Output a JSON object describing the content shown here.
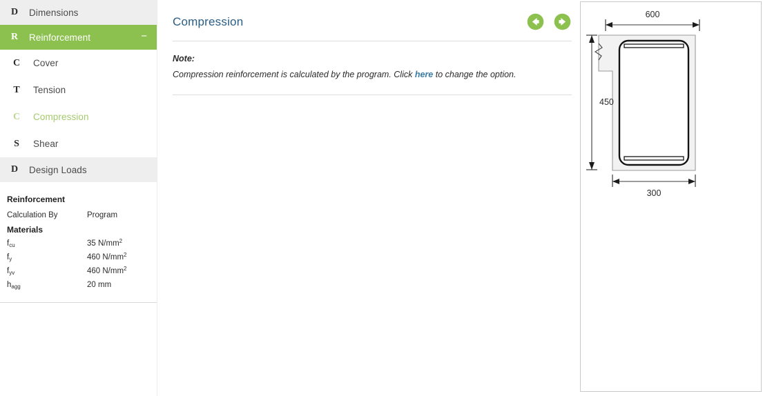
{
  "sidebar": {
    "items": [
      {
        "icon": "letter-d-icon",
        "icon_char": "D",
        "label": "Dimensions",
        "level": "top",
        "state": "normal"
      },
      {
        "icon": "letter-r-icon",
        "icon_char": "R",
        "label": "Reinforcement",
        "level": "top",
        "state": "active",
        "collapse_indicator": "−"
      },
      {
        "icon": "letter-c-icon",
        "icon_char": "C",
        "label": "Cover",
        "level": "sub",
        "state": "normal"
      },
      {
        "icon": "letter-t-icon",
        "icon_char": "T",
        "label": "Tension",
        "level": "sub",
        "state": "normal"
      },
      {
        "icon": "letter-c-icon",
        "icon_char": "C",
        "label": "Compression",
        "level": "sub",
        "state": "current"
      },
      {
        "icon": "letter-s-icon",
        "icon_char": "S",
        "label": "Shear",
        "level": "sub",
        "state": "normal"
      },
      {
        "icon": "letter-d-icon",
        "icon_char": "D",
        "label": "Design Loads",
        "level": "top",
        "state": "normal"
      }
    ],
    "info": {
      "title": "Reinforcement",
      "calculation_by_label": "Calculation By",
      "calculation_by_value": "Program",
      "materials_label": "Materials",
      "materials": [
        {
          "symbol": "f",
          "subscript": "cu",
          "value": "35 N/mm",
          "superscript": "2"
        },
        {
          "symbol": "f",
          "subscript": "y",
          "value": "460 N/mm",
          "superscript": "2"
        },
        {
          "symbol": "f",
          "subscript": "yv",
          "value": "460 N/mm",
          "superscript": "2"
        },
        {
          "symbol": "h",
          "subscript": "agg",
          "value": "20 mm",
          "superscript": ""
        }
      ]
    }
  },
  "main": {
    "title": "Compression",
    "prev_button_label": "Previous",
    "next_button_label": "Next",
    "note": {
      "label": "Note:",
      "text_before": "Compression reinforcement is calculated by the program. Click ",
      "link_text": "here",
      "text_after": " to change the option."
    }
  },
  "diagram": {
    "name": "beam-cross-section",
    "dimensions": {
      "top_width": "600",
      "height": "450",
      "bottom_width": "300"
    }
  },
  "colors": {
    "accent_green": "#8cc04f",
    "title_blue": "#2a5d84",
    "link_blue": "#3a7ca5",
    "row_gray": "#eeeeee",
    "current_green": "#a5c96d"
  }
}
